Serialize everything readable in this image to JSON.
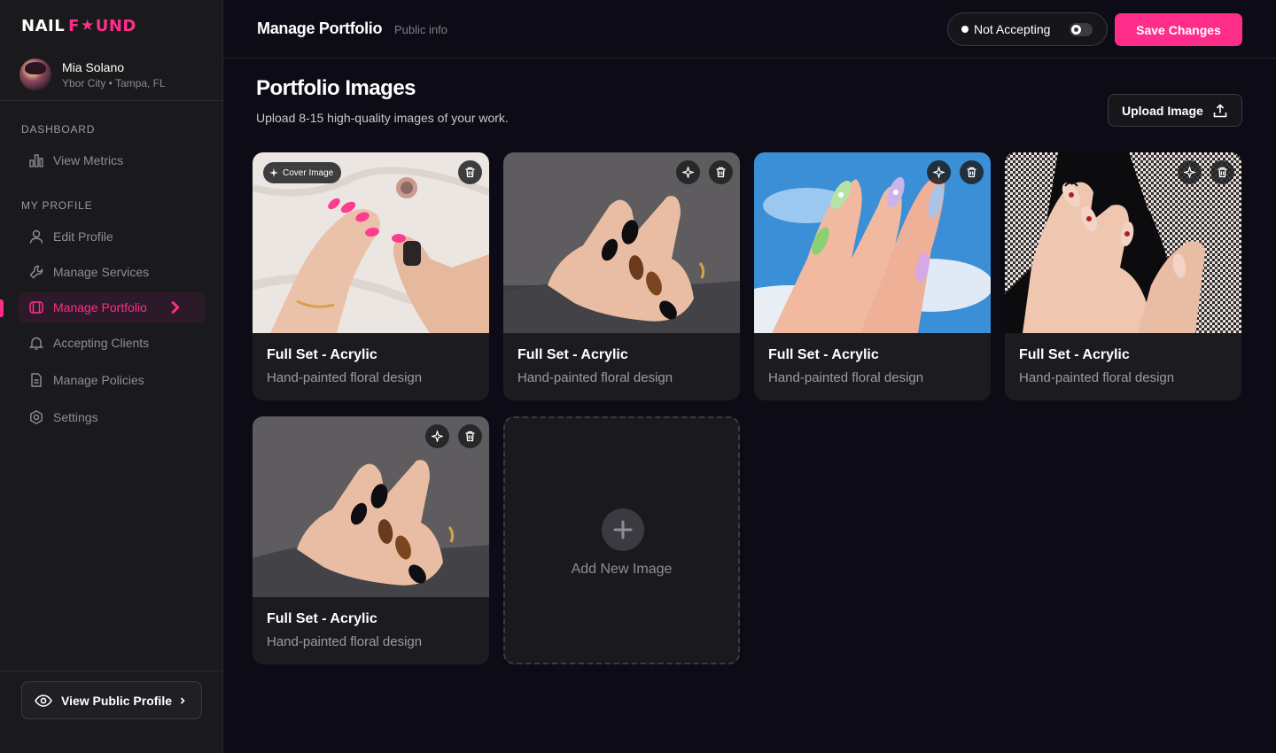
{
  "brand": {
    "logo_left": "NAIL",
    "logo_star": "★",
    "logo_f": "F",
    "logo_right": "UND",
    "accent": "#ff2d8a"
  },
  "user": {
    "name": "Mia Solano",
    "location": "Ybor City • Tampa, FL"
  },
  "sidebar": {
    "dashboard_label": "DASHBOARD",
    "profile_label": "MY PROFILE",
    "items": [
      {
        "label": "View Metrics",
        "icon": "chart-icon"
      },
      {
        "label": "Edit Profile",
        "icon": "user-icon"
      },
      {
        "label": "Manage Services",
        "icon": "wrench-icon"
      },
      {
        "label": "Manage Portfolio",
        "icon": "portfolio-icon",
        "active": true
      },
      {
        "label": "Accepting Clients",
        "icon": "bell-icon"
      },
      {
        "label": "Manage Policies",
        "icon": "document-icon"
      },
      {
        "label": "Settings",
        "icon": "gear-icon"
      }
    ],
    "public_profile_button": "View Public Profile"
  },
  "header": {
    "title": "Manage Portfolio",
    "subtitle": "Public info",
    "status_label": "Not Accepting",
    "accepting": false,
    "save_label": "Save Changes"
  },
  "main": {
    "title": "Portfolio Images",
    "subtitle": "Upload 8-15 high-quality images of your work.",
    "upload_label": "Upload Image",
    "cover_badge": "Cover Image",
    "cards": [
      {
        "title": "Full Set - Acrylic",
        "description": "Hand-painted floral design",
        "cover": true
      },
      {
        "title": "Full Set - Acrylic",
        "description": "Hand-painted floral design"
      },
      {
        "title": "Full Set - Acrylic",
        "description": "Hand-painted floral design"
      },
      {
        "title": "Full Set - Acrylic",
        "description": "Hand-painted floral design"
      },
      {
        "title": "Full Set - Acrylic",
        "description": "Hand-painted floral design"
      }
    ],
    "add_label": "Add New Image"
  }
}
